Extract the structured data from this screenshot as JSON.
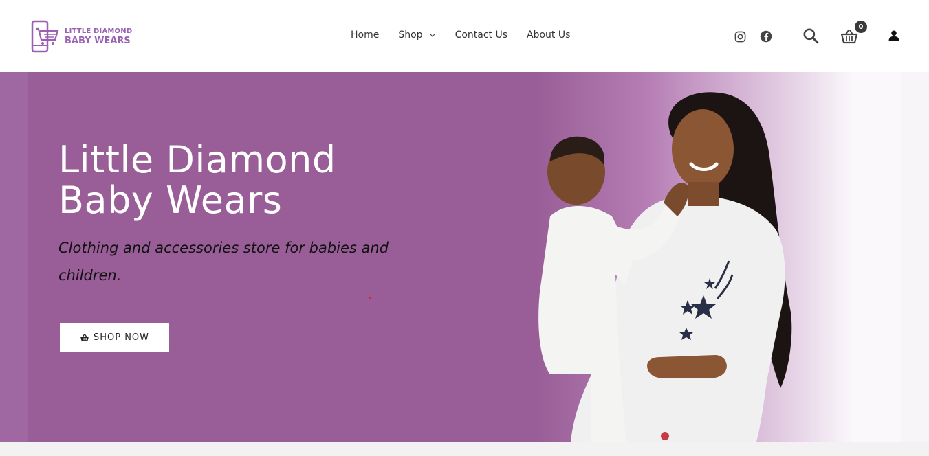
{
  "brand": {
    "line1": "LITTLE DIAMOND",
    "line2": "BABY WEARS",
    "logo_icon": "shopping-cart-phone-icon",
    "color": "#9b5fb4"
  },
  "nav": {
    "items": [
      {
        "label": "Home"
      },
      {
        "label": "Shop",
        "has_dropdown": true
      },
      {
        "label": "Contact Us"
      },
      {
        "label": "About Us"
      }
    ]
  },
  "header_icons": {
    "instagram": "instagram-icon",
    "facebook": "facebook-icon",
    "search": "search-icon",
    "cart": "basket-icon",
    "cart_count": "0",
    "account": "user-icon"
  },
  "hero": {
    "title_line1": "Little Diamond",
    "title_line2": "Baby Wears",
    "subtitle": "Clothing and accessories store for babies and children.",
    "cta_label": "SHOP NOW",
    "cta_icon": "basket-icon",
    "bg_color": "#995e97"
  }
}
